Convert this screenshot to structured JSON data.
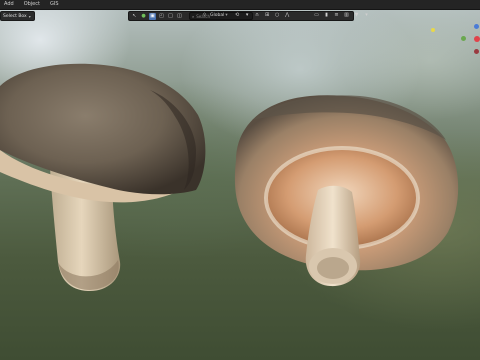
{
  "app": {
    "menu": [
      "Add",
      "Object",
      "GIS"
    ]
  },
  "header": {
    "select_mode": "Select Box",
    "transform_orientation": "Global",
    "search_placeholder": "Search"
  },
  "colors": {
    "x_axis": "#e0434a",
    "y_axis": "#6aa84f",
    "z_axis": "#4a7bd6",
    "gizmo_extra": "#e8d84a",
    "header_bg": "#242424"
  },
  "icons": {
    "select": "arrow-select-icon",
    "orientation": "orientation-icon",
    "snap": "magnet-icon",
    "proportional": "proportional-edit-icon",
    "filter": "filter-icon"
  }
}
